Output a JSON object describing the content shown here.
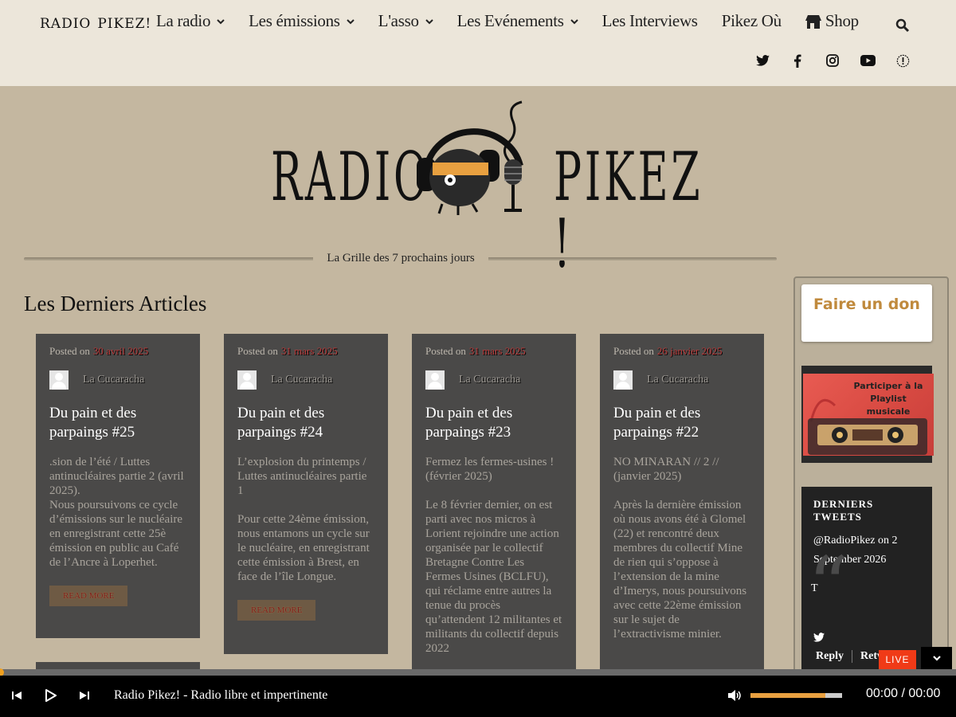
{
  "header": {
    "logo_text": "RADIO PIKEZ!",
    "nav": [
      {
        "label": "La radio",
        "dropdown": true
      },
      {
        "label": "Les émissions",
        "dropdown": true
      },
      {
        "label": "L'asso",
        "dropdown": true
      },
      {
        "label": "Les Evénements",
        "dropdown": true
      },
      {
        "label": "Les Interviews",
        "dropdown": false
      },
      {
        "label": "Pikez Où",
        "dropdown": false
      },
      {
        "label": "Shop",
        "dropdown": false,
        "icon": "store-icon"
      }
    ],
    "search_icon": "search-icon",
    "social_icons": [
      "twitter-icon",
      "facebook-icon",
      "instagram-icon",
      "youtube-icon",
      "info-icon"
    ]
  },
  "hero": {
    "logo_left": "RADIO",
    "logo_right": "PIKEZ !"
  },
  "grid_link": "La Grille des 7 prochains jours",
  "section_title": "Les Derniers Articles",
  "articles": [
    {
      "posted_on": "Posted on",
      "date": "30 avril 2025",
      "author": "La Cucaracha",
      "title": "Du pain et des parpaings #25",
      "excerpt": [
        ".sion de l’été / Luttes antinucléaires partie 2 (avril 2025).\nNous poursuivons ce cycle d’émissions sur le nucléaire en enregistrant cette 25è émission en public au Café de l’Ancre à Loperhet."
      ],
      "read_more": "READ MORE"
    },
    {
      "posted_on": "Posted on",
      "date": "31 mars 2025",
      "author": "La Cucaracha",
      "title": "Du pain et des parpaings #24",
      "excerpt": [
        "L’explosion du printemps / Luttes antinucléaires partie 1",
        "Pour cette 24ème émission, nous entamons un cycle sur le nucléaire, en enregistrant cette émission à Brest, en face de l’île Longue."
      ],
      "read_more": "READ MORE"
    },
    {
      "posted_on": "Posted on",
      "date": "31 mars 2025",
      "author": "La Cucaracha",
      "title": "Du pain et des parpaings #23",
      "excerpt": [
        "Fermez les fermes-usines ! (février 2025)",
        "Le 8 février dernier, on est parti avec nos micros à Lorient rejoindre une action organisée par le collectif Bretagne Contre Les Fermes Usines (BCLFU), qui réclame entre autres la tenue du procès qu’attendent 12 militantes et militants du collectif depuis 2022"
      ],
      "read_more": ""
    },
    {
      "posted_on": "Posted on",
      "date": "26 janvier 2025",
      "author": "La Cucaracha",
      "title": "Du pain et des parpaings #22",
      "excerpt": [
        "NO MINARAN // 2 // (janvier 2025)",
        "Après la dernière émission où nous avons été à Glomel (22) et rencontré deux membres du collectif Mine de rien qui s’oppose à l’extension de la mine d’Imerys, nous poursuivons avec cette 22ème émission sur le sujet de l’extractivisme minier."
      ],
      "read_more": ""
    }
  ],
  "sidebar": {
    "donate_label": "Faire un don",
    "playlist_caption": "Participer à la Playlist musicale",
    "tweets": {
      "heading": "DERNIERS TWEETS",
      "handle_line": "@RadioPikez on 2 September 2026",
      "reply": "Reply",
      "retweet": "Retw",
      "t_glyph": "T"
    }
  },
  "player": {
    "title": "Radio Pikez! - Radio libre et impertinente",
    "time": "00:00 / 00:00",
    "live_label": "LIVE",
    "volume_level": 0.82,
    "progress": 0.0,
    "accent": "#e8a040"
  }
}
